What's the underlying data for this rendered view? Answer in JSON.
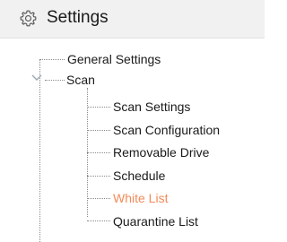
{
  "header": {
    "title": "Settings",
    "icon": "gear-icon"
  },
  "tree": {
    "root_items": [
      {
        "label": "General Settings"
      },
      {
        "label": "Scan",
        "expanded": true,
        "expander_icon": "chevron-down-icon"
      }
    ],
    "scan_children": [
      {
        "label": "Scan Settings"
      },
      {
        "label": "Scan Configuration"
      },
      {
        "label": "Removable Drive"
      },
      {
        "label": "Schedule"
      },
      {
        "label": "White List",
        "selected": true
      },
      {
        "label": "Quarantine List"
      }
    ]
  },
  "colors": {
    "header_bg": "#f1f1f1",
    "selected_text": "#f58a5a",
    "text": "#1a1a1a",
    "connector": "#8a8a8a"
  }
}
